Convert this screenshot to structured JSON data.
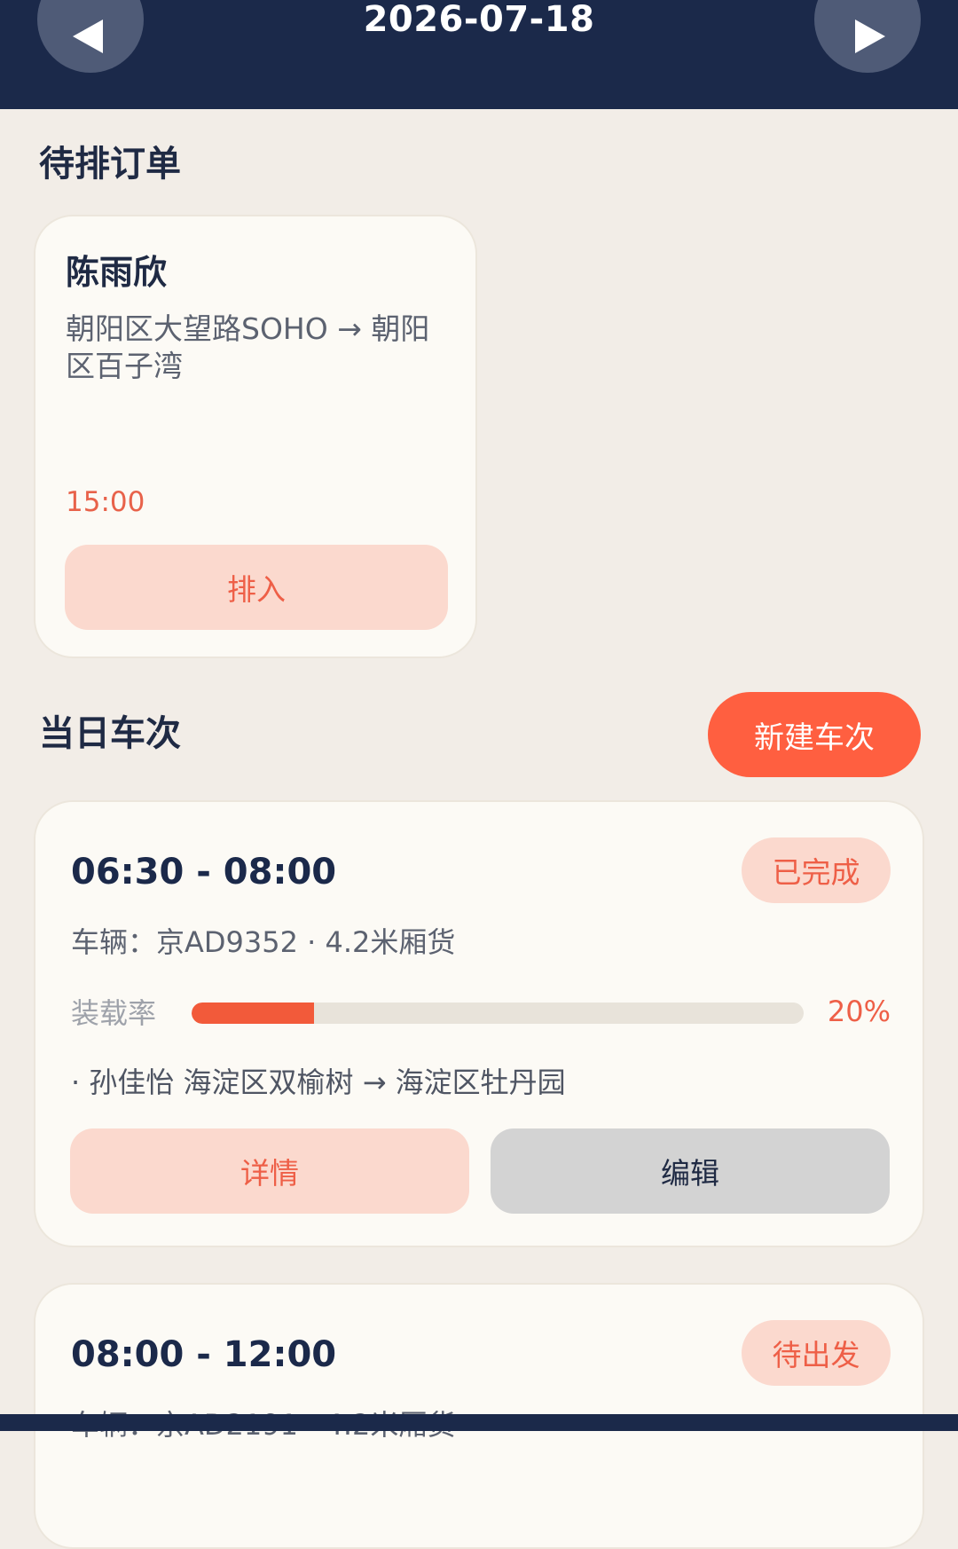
{
  "header": {
    "date": "2026-07-18",
    "prev_icon": "triangle-left-icon",
    "next_icon": "triangle-right-icon",
    "background_color": "#1b294a"
  },
  "pending_section": {
    "title": "待排订单",
    "orders": [
      {
        "name": "陈雨欣",
        "route": "朝阳区大望路SOHO → 朝阳区百子湾",
        "time": "15:00",
        "action_label": "排入"
      }
    ]
  },
  "trips_section": {
    "title": "当日车次",
    "new_button_label": "新建车次",
    "trips": [
      {
        "time_range": "06:30 - 08:00",
        "status": "已完成",
        "vehicle": "车辆：京AD9352 · 4.2米厢货",
        "load_label": "装载率",
        "load_percent": 20,
        "load_text": "20%",
        "orders": [
          "· 孙佳怡 海淀区双榆树 → 海淀区牡丹园"
        ],
        "detail_label": "详情",
        "edit_label": "编辑"
      },
      {
        "time_range": "08:00 - 12:00",
        "status": "待出发",
        "vehicle": "车辆：京AD2191 · 4.2米厢货"
      }
    ]
  },
  "colors": {
    "accent": "#ff5f40",
    "accent_soft": "#fbd9ce",
    "page_background": "#f2ede7",
    "card_background": "#fcfaf5"
  }
}
